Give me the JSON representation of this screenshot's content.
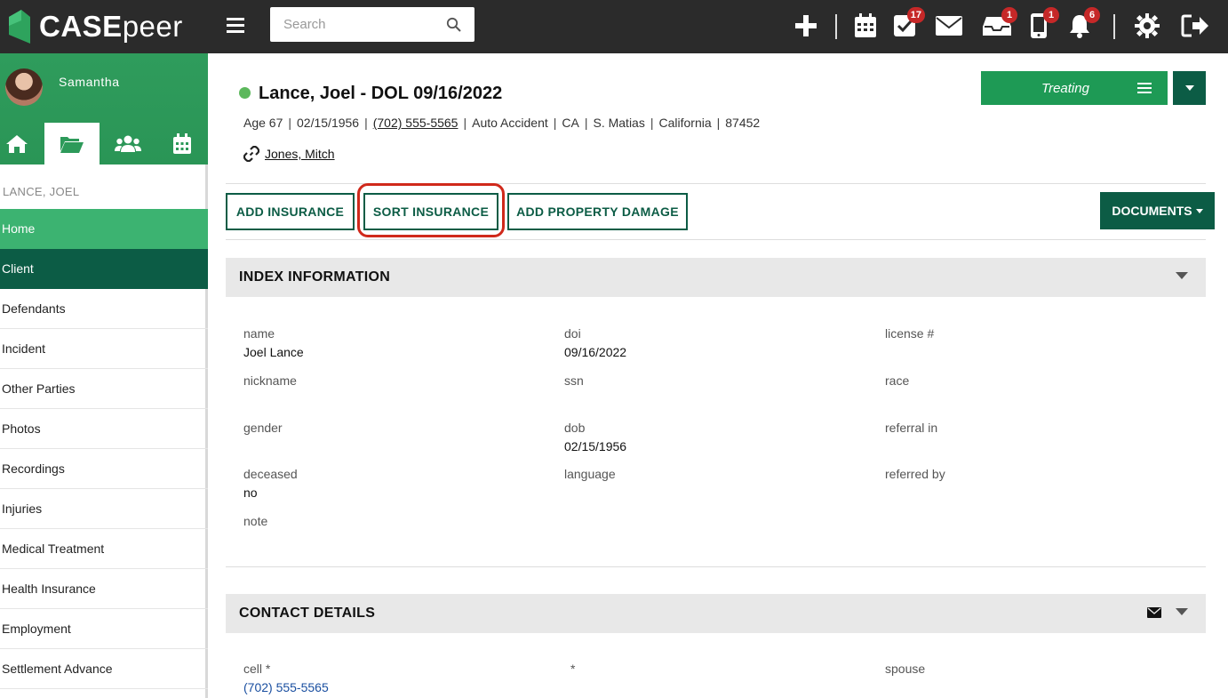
{
  "topbar": {
    "logo_bold": "CASE",
    "logo_light": "peer",
    "search_placeholder": "Search",
    "badges": {
      "tasks": "17",
      "inbox": "1",
      "phone": "1",
      "notifications": "6"
    }
  },
  "sidebar": {
    "username": "Samantha",
    "case_name": "LANCE, JOEL",
    "items": [
      {
        "label": "Home"
      },
      {
        "label": "Client"
      },
      {
        "label": "Defendants"
      },
      {
        "label": "Incident"
      },
      {
        "label": "Other Parties"
      },
      {
        "label": "Photos"
      },
      {
        "label": "Recordings"
      },
      {
        "label": "Injuries"
      },
      {
        "label": "Medical Treatment"
      },
      {
        "label": "Health Insurance"
      },
      {
        "label": "Employment"
      },
      {
        "label": "Settlement Advance"
      }
    ]
  },
  "header": {
    "title": "Lance, Joel - DOL 09/16/2022",
    "meta": {
      "age": "Age 67",
      "dob": "02/15/1956",
      "phone": "(702) 555-5565",
      "case_type": "Auto Accident",
      "state": "CA",
      "attorney": "S. Matias",
      "location": "California",
      "zip": "87452"
    },
    "linked_contact": "Jones, Mitch",
    "status": "Treating"
  },
  "actions": {
    "add_insurance": "ADD INSURANCE",
    "sort_insurance": "SORT INSURANCE",
    "add_property_damage": "ADD PROPERTY DAMAGE",
    "documents": "DOCUMENTS"
  },
  "index_information": {
    "title": "INDEX INFORMATION",
    "fields": {
      "name": {
        "label": "name",
        "value": "Joel Lance"
      },
      "doi": {
        "label": "doi",
        "value": "09/16/2022"
      },
      "license": {
        "label": "license #",
        "value": ""
      },
      "nickname": {
        "label": "nickname",
        "value": ""
      },
      "ssn": {
        "label": "ssn",
        "value": ""
      },
      "race": {
        "label": "race",
        "value": ""
      },
      "gender": {
        "label": "gender",
        "value": ""
      },
      "dob": {
        "label": "dob",
        "value": "02/15/1956"
      },
      "referral_in": {
        "label": "referral in",
        "value": ""
      },
      "deceased": {
        "label": "deceased",
        "value": "no"
      },
      "language": {
        "label": "language",
        "value": ""
      },
      "referred_by": {
        "label": "referred by",
        "value": ""
      },
      "note": {
        "label": "note",
        "value": ""
      }
    }
  },
  "contact_details": {
    "title": "CONTACT DETAILS",
    "fields": {
      "cell": {
        "label": "cell *",
        "value": "(702) 555-5565"
      },
      "unnamed": {
        "label": "*",
        "value": ""
      },
      "spouse": {
        "label": "spouse",
        "value": ""
      }
    }
  }
}
